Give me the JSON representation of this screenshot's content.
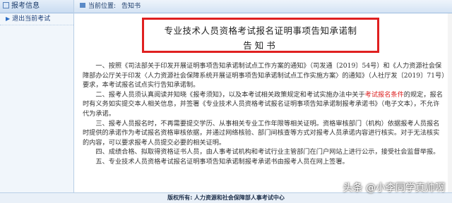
{
  "sidebar": {
    "header": "报考信息",
    "items": [
      {
        "label": "退出当前考试"
      }
    ]
  },
  "breadcrumb": {
    "prefix": "当前位置:",
    "current": "告知书"
  },
  "notice": {
    "title_line1": "专业技术人员资格考试报名证明事项告知承诺制",
    "title_line2": "告知书",
    "p1": "一、按照《司法部关于印发开展证明事项告知承诺制试点工作方案的通知》（司发通〔2019〕54号）和《人力资源社会保障部办公厅关于印发〈人力资源社会保障系统开展证明事项告知承诺制试点工作实施方案〉的通知》（人社厅发〔2019〕71号）要求，本考试报名试点实行告知承诺制。",
    "p2a": "二、报考人员须认真阅读并知晓《报考须知》，以及本考试相关政策规定和考试实施办法中关于",
    "p2_highlight": "考试报名条件",
    "p2b": "的规定，报名时有义务如实提交本人相关信息，并签署《专业技术人员资格考试报名证明事项告知承诺制报考承诺书》（电子文本），不允许代为承诺。",
    "p3": "三、报考人员报名时，不再需要提交学历、从事相关专业工作年限等相关证明。资格审核部门（机构）依据报考人员报名时提供的承诺作为考试报名资格审核依据，并通过网络核验、部门间核查等方式对报考人员承诺内容进行核实。对于无法核实的内容，可以要求报考人员提交必要的相关证明。",
    "p4": "四、成绩合格、拟取得资格证书人员，由人事考试机构和考试行业主管部门在门户网站上进行公示，接受社会监督举报。",
    "p5": "五、专业技术人员资格考试报名证明事项告知承诺制报考承诺书由报考人员在网上签署。"
  },
  "footer": {
    "label": "版权所有:",
    "org": "人力资源和社会保障部人事考试中心"
  },
  "watermark": "头条 @小李同学真帅啊"
}
